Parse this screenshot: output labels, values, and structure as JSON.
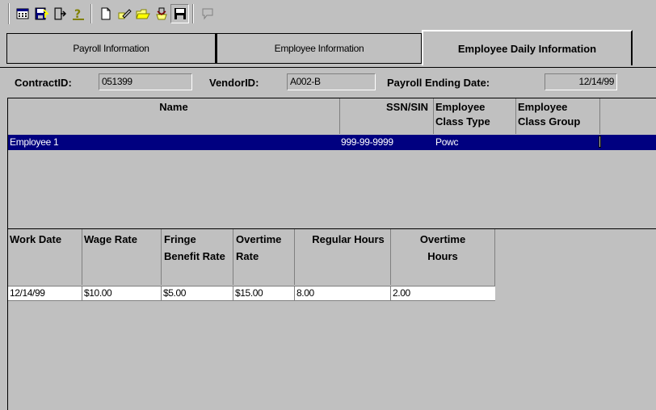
{
  "toolbar": {
    "buttons": [
      {
        "icon": "calculator-icon"
      },
      {
        "icon": "save-disk-icon"
      },
      {
        "icon": "exit-door-icon"
      },
      {
        "icon": "help-icon"
      },
      {
        "icon": "new-document-icon"
      },
      {
        "icon": "edit-icon"
      },
      {
        "icon": "open-folder-icon"
      },
      {
        "icon": "import-icon"
      },
      {
        "icon": "floppy-disk-icon"
      },
      {
        "icon": "comment-bubble-icon"
      }
    ]
  },
  "tabs": [
    {
      "label": "Payroll Information",
      "active": false
    },
    {
      "label": "Employee Information",
      "active": false
    },
    {
      "label": "Employee Daily Information",
      "active": true
    }
  ],
  "header": {
    "contract_label": "ContractID:",
    "contract_value": "051399",
    "vendor_label": "VendorID:",
    "vendor_value": "A002-B",
    "payroll_label": "Payroll Ending Date:",
    "payroll_value": "12/14/99"
  },
  "employee_grid": {
    "columns": [
      "Name",
      "SSN/SIN",
      "Employee Class Type",
      "Employee Class Group"
    ],
    "rows": [
      {
        "name": "Employee 1",
        "ssn": "999-99-9999",
        "class_type": "Powc",
        "class_group": ""
      }
    ]
  },
  "daily_grid": {
    "columns": [
      "Work Date",
      "Wage Rate",
      "Fringe Benefit Rate",
      "Overtime Rate",
      "Regular Hours",
      "Overtime Hours"
    ],
    "rows": [
      {
        "work_date": "12/14/99",
        "wage_rate": "$10.00",
        "fringe": "$5.00",
        "overtime_rate": "$15.00",
        "regular_hours": "8.00",
        "overtime_hours": "2.00"
      }
    ]
  },
  "colors": {
    "window_bg": "#c0c0c0",
    "selection": "#000080",
    "row_bg": "#ffffff"
  }
}
